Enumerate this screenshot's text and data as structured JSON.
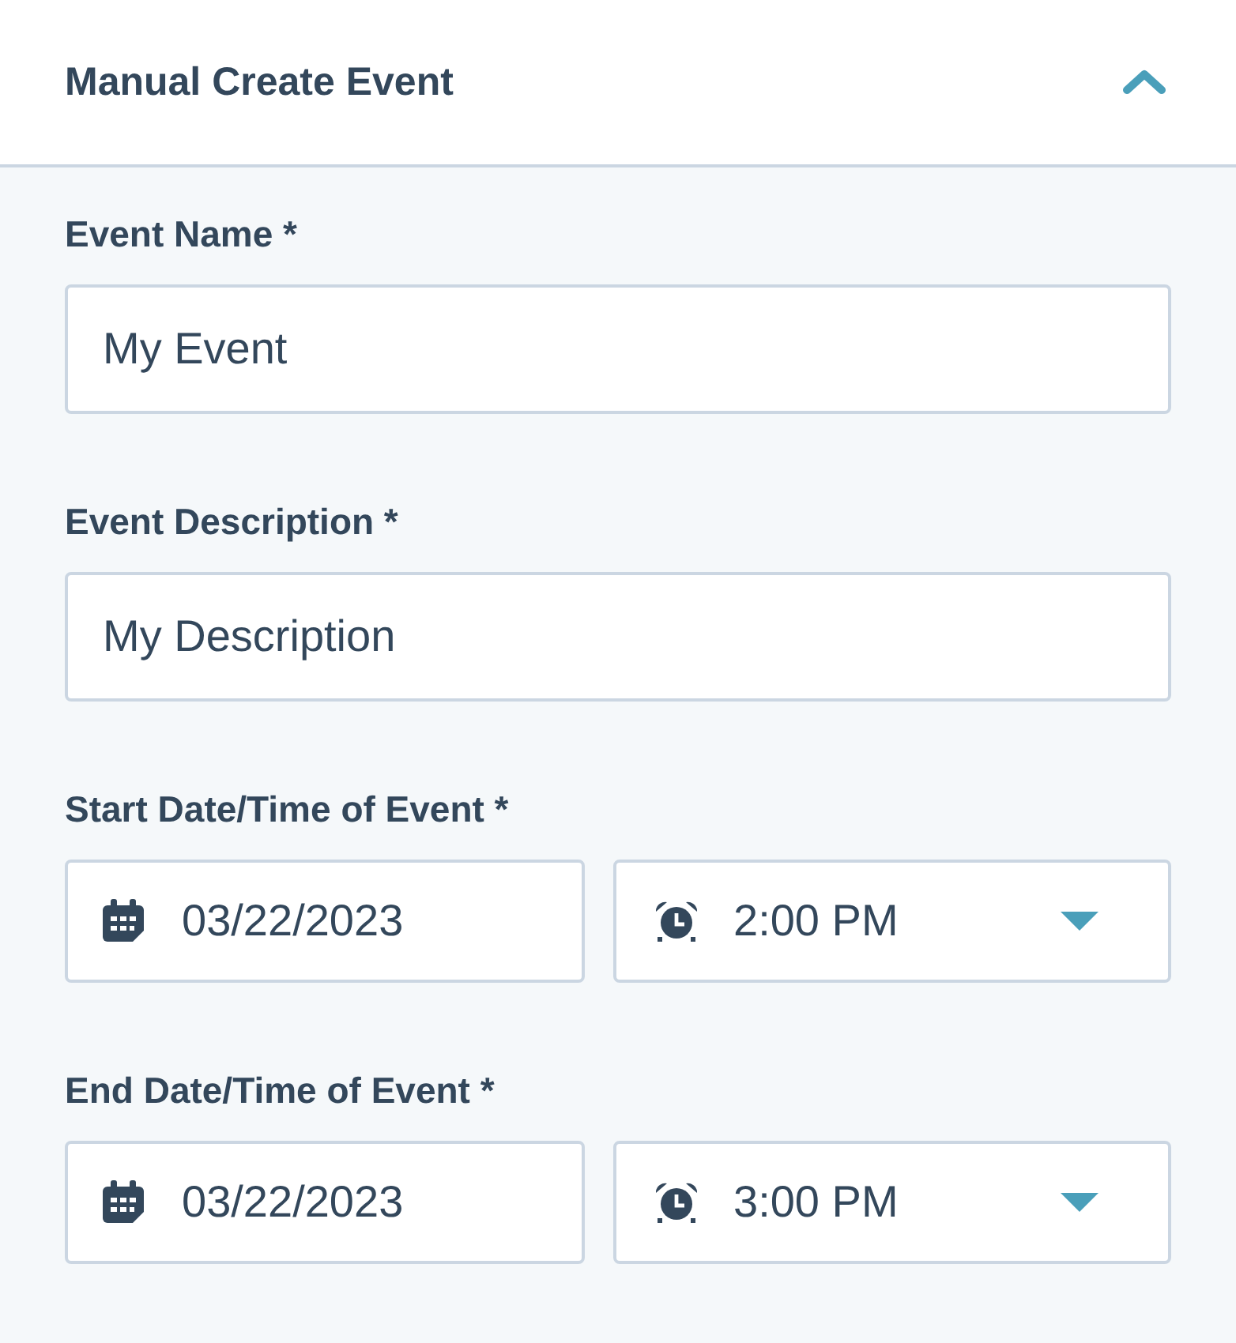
{
  "panel": {
    "title": "Manual Create Event",
    "expanded": true
  },
  "fields": [
    {
      "kind": "text",
      "label": "Event Name *",
      "value": "My Event"
    },
    {
      "kind": "text",
      "label": "Event Description *",
      "value": "My Description"
    },
    {
      "kind": "datetime",
      "label": "Start Date/Time of Event *",
      "date": "03/22/2023",
      "time": "2:00 PM"
    },
    {
      "kind": "datetime",
      "label": "End Date/Time of Event *",
      "date": "03/22/2023",
      "time": "3:00 PM"
    }
  ]
}
